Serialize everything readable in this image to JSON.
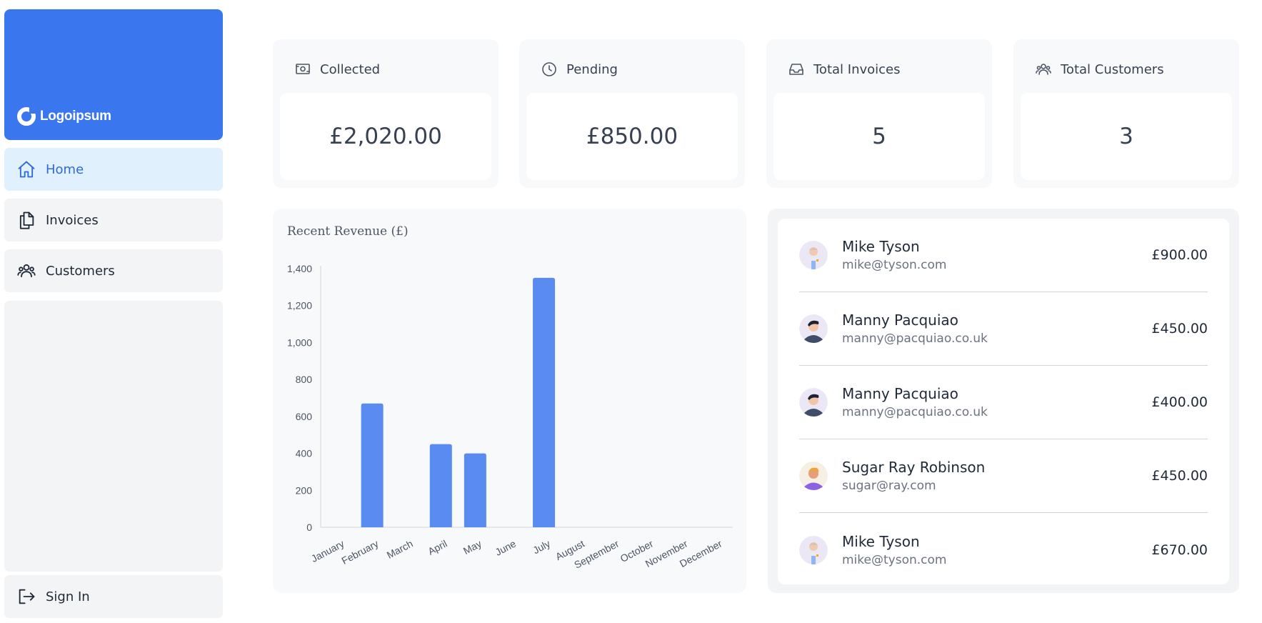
{
  "sidebar": {
    "logo_text": "Logoipsum",
    "nav": [
      {
        "label": "Home",
        "icon": "home-icon"
      },
      {
        "label": "Invoices",
        "icon": "documents-icon"
      },
      {
        "label": "Customers",
        "icon": "users-icon"
      }
    ],
    "sign_in": {
      "label": "Sign In",
      "icon": "sign-in-icon"
    }
  },
  "cards": [
    {
      "label": "Collected",
      "value": "£2,020.00",
      "icon": "banknotes-icon"
    },
    {
      "label": "Pending",
      "value": "£850.00",
      "icon": "clock-icon"
    },
    {
      "label": "Total Invoices",
      "value": "5",
      "icon": "inbox-icon"
    },
    {
      "label": "Total Customers",
      "value": "3",
      "icon": "users-icon"
    }
  ],
  "revenue_chart": {
    "title": "Recent Revenue (£)"
  },
  "chart_data": {
    "type": "bar",
    "title": "Recent Revenue (£)",
    "xlabel": "",
    "ylabel": "",
    "categories": [
      "January",
      "February",
      "March",
      "April",
      "May",
      "June",
      "July",
      "August",
      "September",
      "October",
      "November",
      "December"
    ],
    "values": [
      0,
      670,
      0,
      450,
      400,
      0,
      1350,
      0,
      0,
      0,
      0,
      0
    ],
    "ylim": [
      0,
      1400
    ],
    "yticks": [
      "0",
      "200",
      "400",
      "600",
      "800",
      "1,000",
      "1,200",
      "1,400"
    ],
    "bar_color": "#5a8bf0",
    "grid": false
  },
  "latest_invoices": [
    {
      "name": "Mike Tyson",
      "email": "mike@tyson.com",
      "amount": "£900.00",
      "avatar": "avatar-mike"
    },
    {
      "name": "Manny Pacquiao",
      "email": "manny@pacquiao.co.uk",
      "amount": "£450.00",
      "avatar": "avatar-manny"
    },
    {
      "name": "Manny Pacquiao",
      "email": "manny@pacquiao.co.uk",
      "amount": "£400.00",
      "avatar": "avatar-manny"
    },
    {
      "name": "Sugar Ray Robinson",
      "email": "sugar@ray.com",
      "amount": "£450.00",
      "avatar": "avatar-sugar"
    },
    {
      "name": "Mike Tyson",
      "email": "mike@tyson.com",
      "amount": "£670.00",
      "avatar": "avatar-mike"
    }
  ],
  "colors": {
    "accent": "#3a76ee",
    "active_nav_bg": "#e0f0fd",
    "active_nav_text": "#2f6ad9"
  }
}
